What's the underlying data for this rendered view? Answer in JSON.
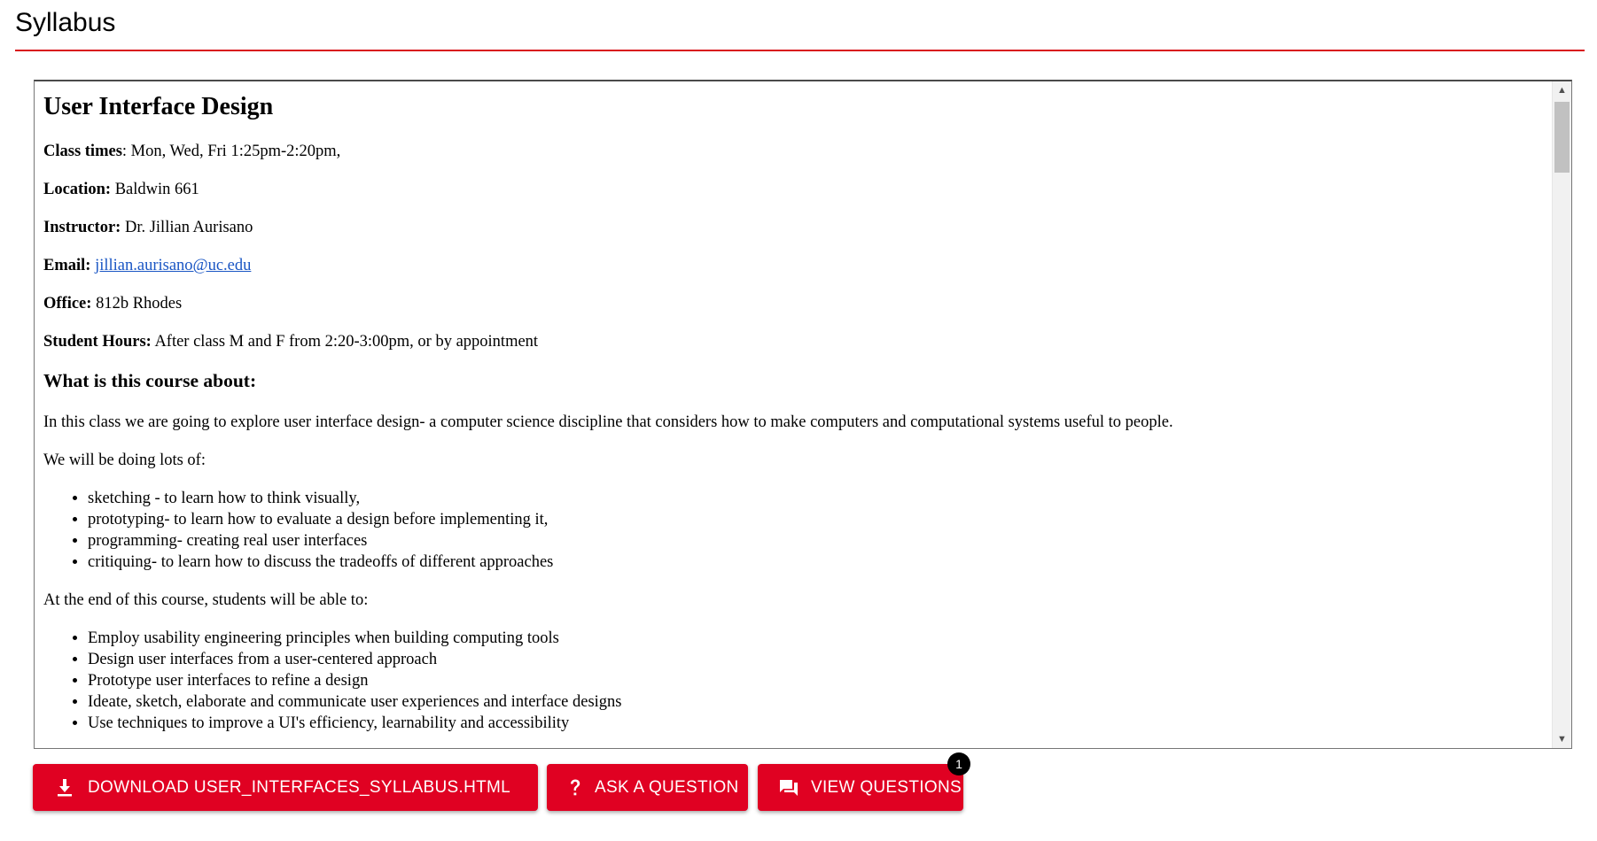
{
  "header": {
    "title": "Syllabus"
  },
  "syllabus": {
    "title": "User Interface Design",
    "info": [
      {
        "label": "Class times",
        "sep": ": ",
        "value": "Mon, Wed, Fri 1:25pm-2:20pm,"
      },
      {
        "label": "Location:",
        "sep": " ",
        "value": "Baldwin 661"
      },
      {
        "label": "Instructor:",
        "sep": " ",
        "value": "Dr. Jillian Aurisano"
      },
      {
        "label": "Email:",
        "sep": " ",
        "value": "jillian.aurisano@uc.edu",
        "is_link": true
      },
      {
        "label": "Office:",
        "sep": " ",
        "value": "812b Rhodes"
      },
      {
        "label": "Student Hours:",
        "sep": " ",
        "value": "After class M and F from 2:20-3:00pm, or by appointment"
      }
    ],
    "about_heading": "What is this course about:",
    "about_text": "In this class we are going to explore user interface design- a computer science discipline that considers how to make computers and computational systems useful to people.",
    "doing_intro": "We will be doing lots of:",
    "doing_items": [
      "sketching - to learn how to think visually,",
      "prototyping- to learn how to evaluate a design before implementing it,",
      "programming- creating real user interfaces",
      "critiquing- to learn how to discuss the tradeoffs of different approaches"
    ],
    "outcomes_intro": "At the end of this course, students will be able to:",
    "outcomes_items": [
      "Employ usability engineering principles when building computing tools",
      "Design user interfaces from a user-centered approach",
      "Prototype user interfaces to refine a design",
      "Ideate, sketch, elaborate and communicate user experiences and interface designs",
      "Use techniques to improve a UI's efficiency, learnability and accessibility"
    ]
  },
  "actions": {
    "download_label": "DOWNLOAD USER_INTERFACES_SYLLABUS.HTML",
    "ask_label": "ASK A QUESTION",
    "view_label": "VIEW QUESTIONS",
    "view_badge": "1"
  },
  "icons": {
    "download": "download-icon",
    "ask": "question-mark-icon",
    "view": "forum-icon"
  },
  "colors": {
    "accent": "#e00122",
    "header_rule": "#d9141b",
    "link": "#1a56c4",
    "badge": "#000000"
  }
}
